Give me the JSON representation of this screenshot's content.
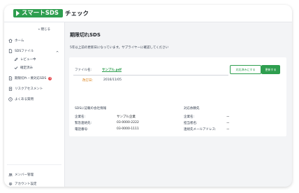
{
  "header": {
    "logo_text": "スマートSDS",
    "logo_suffix": "チェック"
  },
  "sidebar": {
    "collapse_label": "« 閉じる",
    "items": [
      {
        "label": "ホーム"
      },
      {
        "label": "SDSファイル"
      },
      {
        "label": "レビュー中"
      },
      {
        "label": "確定済み"
      },
      {
        "label": "期限切れ・要対応SDS",
        "badge": "3"
      },
      {
        "label": "リスクアセスメント"
      },
      {
        "label": "よくある質問"
      },
      {
        "label": "メンバー管理"
      },
      {
        "label": "アカウント設定"
      }
    ],
    "sds_chevron": "^"
  },
  "main": {
    "title": "期限切れSDS",
    "description": "5年以上前の更新日になっています。サプライヤーに確認してください",
    "file": {
      "label": "ファイル名:",
      "name": "サンプル.pdf",
      "revision_label": "改訂日：",
      "revision_value": "2016/11/05",
      "confirm_button": "対応済みにする",
      "update_button": "更新する"
    },
    "info": {
      "left_heading": "SDSに記載の会社情報",
      "left_rows": [
        {
          "key": "企業名:",
          "value": "サンプル企業"
        },
        {
          "key": "緊急連絡先:",
          "value": "03-0000-2222"
        },
        {
          "key": "電話番号:",
          "value": "03-0000-1111"
        }
      ],
      "right_heading": "対応依頼先",
      "right_rows": [
        {
          "key": "企業名:",
          "value": "ー"
        },
        {
          "key": "担当者名:",
          "value": "ー"
        },
        {
          "key": "連絡先メールアドレス:",
          "value": "ー"
        }
      ]
    }
  },
  "colors": {
    "accent": "#2e9e4f",
    "warning": "#d97706",
    "badge": "#e5484d"
  },
  "icons": {
    "home": "home-icon",
    "sds": "file-icon",
    "review": "pencil-icon",
    "done": "check-icon",
    "expired": "document-warning-icon",
    "risk": "clipboard-icon",
    "faq": "help-icon",
    "members": "users-icon",
    "account": "gear-icon"
  }
}
